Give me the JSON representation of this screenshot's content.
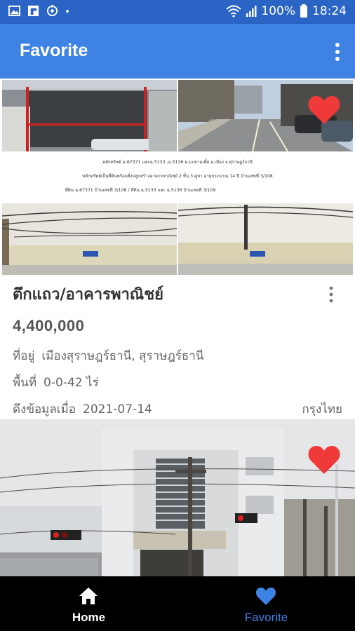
{
  "status_bar": {
    "battery": "100%",
    "time": "18:24"
  },
  "app_bar": {
    "title": "Favorite"
  },
  "listings": [
    {
      "title": "ตึกแถว/อาคารพาณิชย์",
      "price": "4,400,000",
      "address_label": "ที่อยู่",
      "address": "เมืองสุราษฎร์ธานี, สุราษฎร์ธานี",
      "area_label": "พื้นที่",
      "area": "0-0-42 ไร่",
      "fetched_label": "ดึงข้อมูลเมื่อ",
      "fetched_date": "2021-07-14",
      "bank": "กรุงไทย",
      "favorited": true,
      "photo_caption_lines": [
        "หลักทรัพย์ ฉ.67371 และฉ.5133 ,ฉ.5136 ต.มะขามเตี้ย อ.เมือง จ.สุราษฎร์ธานี",
        "หลักทรัพย์เป็นที่ดินพร้อมสิ่งปลูกสร้างอาคารพาณิชย์ 2 ชั้น 3 คูหา อายุประมาณ 14 ปี บ้านเลขที่ 3/108",
        "ที่ดิน ฉ.67371 บ้านเลขที่ 3/108 / ที่ดิน ฉ.5133 และ ฉ.5136 บ้านเลขที่ 3/109"
      ]
    },
    {
      "favorited": true
    }
  ],
  "bottom_nav": [
    {
      "label": "Home",
      "icon": "home-icon",
      "active": false
    },
    {
      "label": "Favorite",
      "icon": "heart-icon",
      "active": true
    }
  ],
  "colors": {
    "status_bar": "#2a64c4",
    "app_bar": "#3e82e4",
    "heart": "#f03a3a",
    "nav_active": "#3e82e4"
  }
}
